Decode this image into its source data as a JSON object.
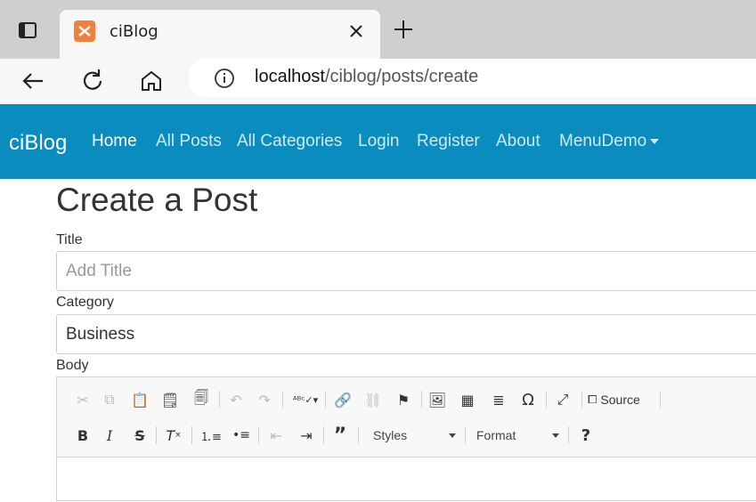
{
  "browser": {
    "tab_title": "ciBlog",
    "url_host": "localhost",
    "url_path": "/ciblog/posts/create"
  },
  "navbar": {
    "brand": "ciBlog",
    "items": [
      "Home",
      "All Posts",
      "All Categories",
      "Login",
      "Register",
      "About",
      "MenuDemo"
    ]
  },
  "page": {
    "title": "Create a Post",
    "title_label": "Title",
    "title_placeholder": "Add Title",
    "category_label": "Category",
    "category_value": "Business",
    "body_label": "Body"
  },
  "editor": {
    "source_label": "Source",
    "styles_label": "Styles",
    "format_label": "Format"
  }
}
